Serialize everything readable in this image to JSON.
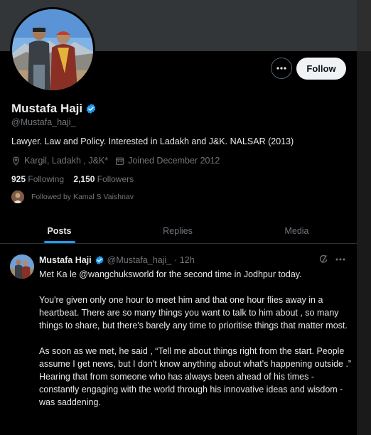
{
  "profile": {
    "name": "Mustafa Haji",
    "handle": "@Mustafa_haji_",
    "bio": "Lawyer. Law and Policy. Interested in Ladakh and J&K. NALSAR (2013)",
    "location": "Kargil, Ladakh , J&K*",
    "joined": "Joined December 2012",
    "following_count": "925",
    "following_label": "Following",
    "followers_count": "2,150",
    "followers_label": "Followers",
    "followed_by": "Followed by Kamal S Vaishnav"
  },
  "actions": {
    "follow_label": "Follow",
    "more_icon": "more-horizontal-icon"
  },
  "tabs": [
    {
      "label": "Posts",
      "active": true
    },
    {
      "label": "Replies",
      "active": false
    },
    {
      "label": "Media",
      "active": false
    }
  ],
  "tweet": {
    "author": "Mustafa Haji",
    "handle": "@Mustafa_haji_",
    "time": "· 12h",
    "paragraphs": [
      "Met Ka le @wangchuksworld for the second time in Jodhpur today.",
      "You're given only one hour to meet him and that one hour flies away in a heartbeat. There are so many things you want to talk to him about , so many things to share, but there's barely any time to prioritise things that matter most.",
      "As soon as we met, he said , “Tell me about things right from the start. People assume I get news, but I don't know anything about what's happening outside .”",
      "Hearing that from someone who has always been ahead of his times - constantly engaging with the world through his innovative ideas and wisdom - was saddening."
    ]
  },
  "colors": {
    "accent": "#1d9bf0",
    "verified": "#1d9bf0",
    "banner": "#333639",
    "background": "#000000",
    "muted": "#71767b"
  }
}
